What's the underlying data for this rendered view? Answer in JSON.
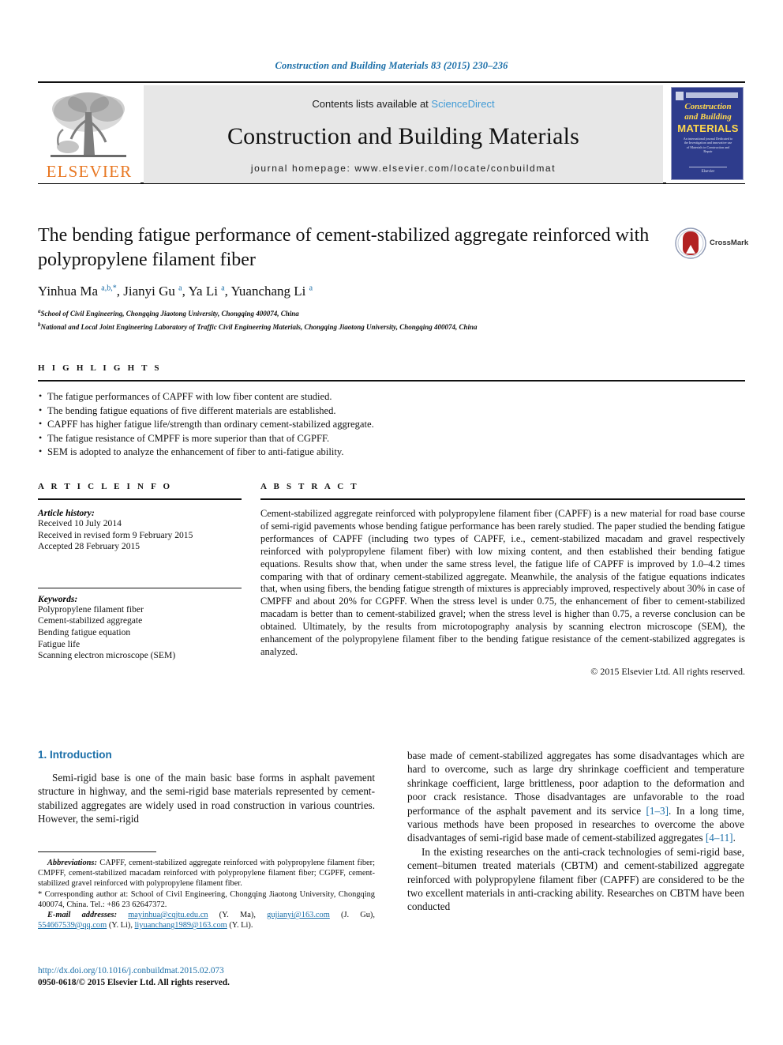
{
  "running_head": "Construction and Building Materials 83 (2015) 230–236",
  "masthead": {
    "publisher": "ELSEVIER",
    "contents_prefix": "Contents lists available at ",
    "contents_link": "ScienceDirect",
    "journal_title": "Construction and Building Materials",
    "homepage": "journal homepage: www.elsevier.com/locate/conbuildmat",
    "cover": {
      "line1": "Construction",
      "line2": "and Building",
      "line3": "MATERIALS",
      "subtext": "An international journal Dedicated to the Investigation and innovative use of Materials in Construction and Repair",
      "footer": "Elsevier"
    }
  },
  "title": "The bending fatigue performance of cement-stabilized aggregate reinforced with polypropylene filament fiber",
  "authors_html": "Yinhua Ma <sup>a,b,*</sup>, Jianyi Gu <sup>a</sup>, Ya Li <sup>a</sup>, Yuanchang Li <sup>a</sup>",
  "affiliations": [
    "a School of Civil Engineering, Chongqing Jiaotong University, Chongqing 400074, China",
    "b National and Local Joint Engineering Laboratory of Traffic Civil Engineering Materials, Chongqing Jiaotong University, Chongqing 400074, China"
  ],
  "crossmark_label": "CrossMark",
  "highlights": {
    "heading": "H I G H L I G H T S",
    "items": [
      "The fatigue performances of CAPFF with low fiber content are studied.",
      "The bending fatigue equations of five different materials are established.",
      "CAPFF has higher fatigue life/strength than ordinary cement-stabilized aggregate.",
      "The fatigue resistance of CMPFF is more superior than that of CGPFF.",
      "SEM is adopted to analyze the enhancement of fiber to anti-fatigue ability."
    ]
  },
  "article_info": {
    "heading": "A R T I C L E    I N F O",
    "history_label": "Article history:",
    "history": [
      "Received 10 July 2014",
      "Received in revised form 9 February 2015",
      "Accepted 28 February 2015"
    ],
    "keywords_label": "Keywords:",
    "keywords": [
      "Polypropylene filament fiber",
      "Cement-stabilized aggregate",
      "Bending fatigue equation",
      "Fatigue life",
      "Scanning electron microscope (SEM)"
    ]
  },
  "abstract": {
    "heading": "A B S T R A C T",
    "text": "Cement-stabilized aggregate reinforced with polypropylene filament fiber (CAPFF) is a new material for road base course of semi-rigid pavements whose bending fatigue performance has been rarely studied. The paper studied the bending fatigue performances of CAPFF (including two types of CAPFF, i.e., cement-stabilized macadam and gravel respectively reinforced with polypropylene filament fiber) with low mixing content, and then established their bending fatigue equations. Results show that, when under the same stress level, the fatigue life of CAPFF is improved by 1.0–4.2 times comparing with that of ordinary cement-stabilized aggregate. Meanwhile, the analysis of the fatigue equations indicates that, when using fibers, the bending fatigue strength of mixtures is appreciably improved, respectively about 30% in case of CMPFF and about 20% for CGPFF. When the stress level is under 0.75, the enhancement of fiber to cement-stabilized macadam is better than to cement-stabilized gravel; when the stress level is higher than 0.75, a reverse conclusion can be obtained. Ultimately, by the results from microtopography analysis by scanning electron microscope (SEM), the enhancement of the polypropylene filament fiber to the bending fatigue resistance of the cement-stabilized aggregates is analyzed.",
    "copyright": "© 2015 Elsevier Ltd. All rights reserved."
  },
  "body": {
    "section_heading": "1. Introduction",
    "left_paragraph": "Semi-rigid base is one of the main basic base forms in asphalt pavement structure in highway, and the semi-rigid base materials represented by cement-stabilized aggregates are widely used in road construction in various countries. However, the semi-rigid",
    "right_paragraph_1_pre": "base made of cement-stabilized aggregates has some disadvantages which are hard to overcome, such as large dry shrinkage coefficient and temperature shrinkage coefficient, large brittleness, poor adaption to the deformation and poor crack resistance. Those disadvantages are unfavorable to the road performance of the asphalt pavement and its service ",
    "right_ref_1": "[1–3]",
    "right_paragraph_1_mid": ". In a long time, various methods have been proposed in researches to overcome the above disadvantages of semi-rigid base made of cement-stabilized aggregates ",
    "right_ref_2": "[4–11]",
    "right_paragraph_1_post": ".",
    "right_paragraph_2": "In the existing researches on the anti-crack technologies of semi-rigid base, cement–bitumen treated materials (CBTM) and cement-stabilized aggregate reinforced with polypropylene filament fiber (CAPFF) are considered to be the two excellent materials in anti-cracking ability. Researches on CBTM have been conducted"
  },
  "footnotes": {
    "abbrev_label": "Abbreviations:",
    "abbrev_text": " CAPFF, cement-stabilized aggregate reinforced with polypropylene filament fiber; CMPFF, cement-stabilized macadam reinforced with polypropylene filament fiber; CGPFF, cement-stabilized gravel reinforced with polypropylene filament fiber.",
    "corresponding": "* Corresponding author at: School of Civil Engineering, Chongqing Jiaotong University, Chongqing 400074, China. Tel.: +86 23 62647372.",
    "email_label": "E-mail addresses:",
    "emails": [
      {
        "address": "mayinhua@cqjtu.edu.cn",
        "person": " (Y. Ma), "
      },
      {
        "address": "gujianyi@163.com",
        "person": " (J. Gu), "
      },
      {
        "address": "554667539@qq.com",
        "person": " (Y. Li), "
      },
      {
        "address": "liyuanchang1989@163.com",
        "person": " (Y. Li)."
      }
    ]
  },
  "doi": {
    "url": "http://dx.doi.org/10.1016/j.conbuildmat.2015.02.073",
    "issn_line": "0950-0618/© 2015 Elsevier Ltd. All rights reserved."
  },
  "colors": {
    "link_blue": "#1a6ea8",
    "sciencedirect_blue": "#3f9ad6",
    "elsevier_orange": "#E87722",
    "cover_navy": "#2e3c8c",
    "cover_yellow": "#ffd84d"
  }
}
